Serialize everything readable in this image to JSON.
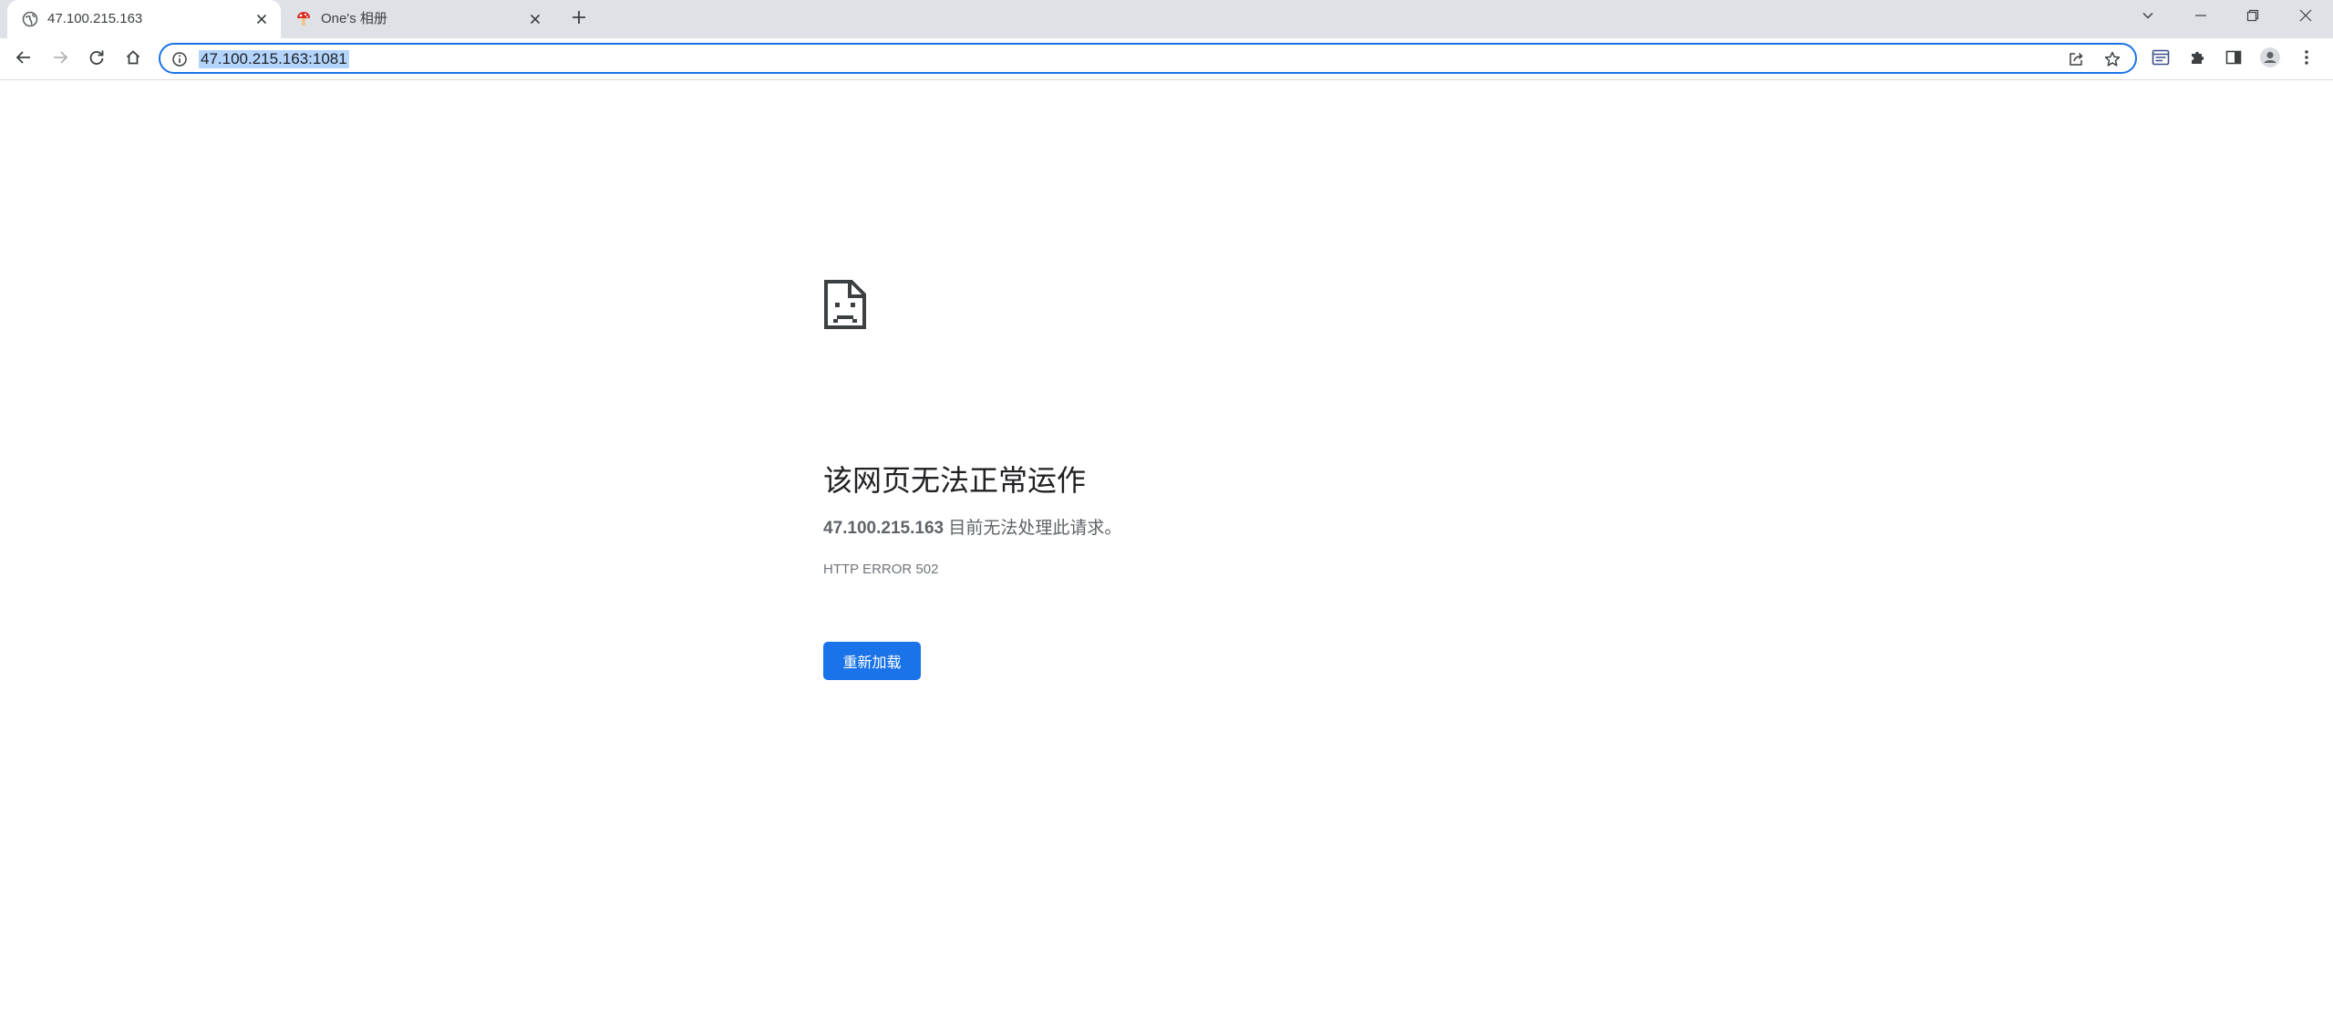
{
  "tabs": [
    {
      "title": "47.100.215.163",
      "favicon": "globe-icon",
      "active": true
    },
    {
      "title": "One's 相册",
      "favicon": "mushroom-icon",
      "active": false
    }
  ],
  "omnibox": {
    "url": "47.100.215.163:1081"
  },
  "error": {
    "heading": "该网页无法正常运作",
    "host": "47.100.215.163",
    "message": " 目前无法处理此请求。",
    "code": "HTTP ERROR 502",
    "reload_label": "重新加载"
  },
  "colors": {
    "accent": "#1a73e8",
    "tabstrip": "#dee1e6",
    "url_selection": "#b3d4fc"
  }
}
